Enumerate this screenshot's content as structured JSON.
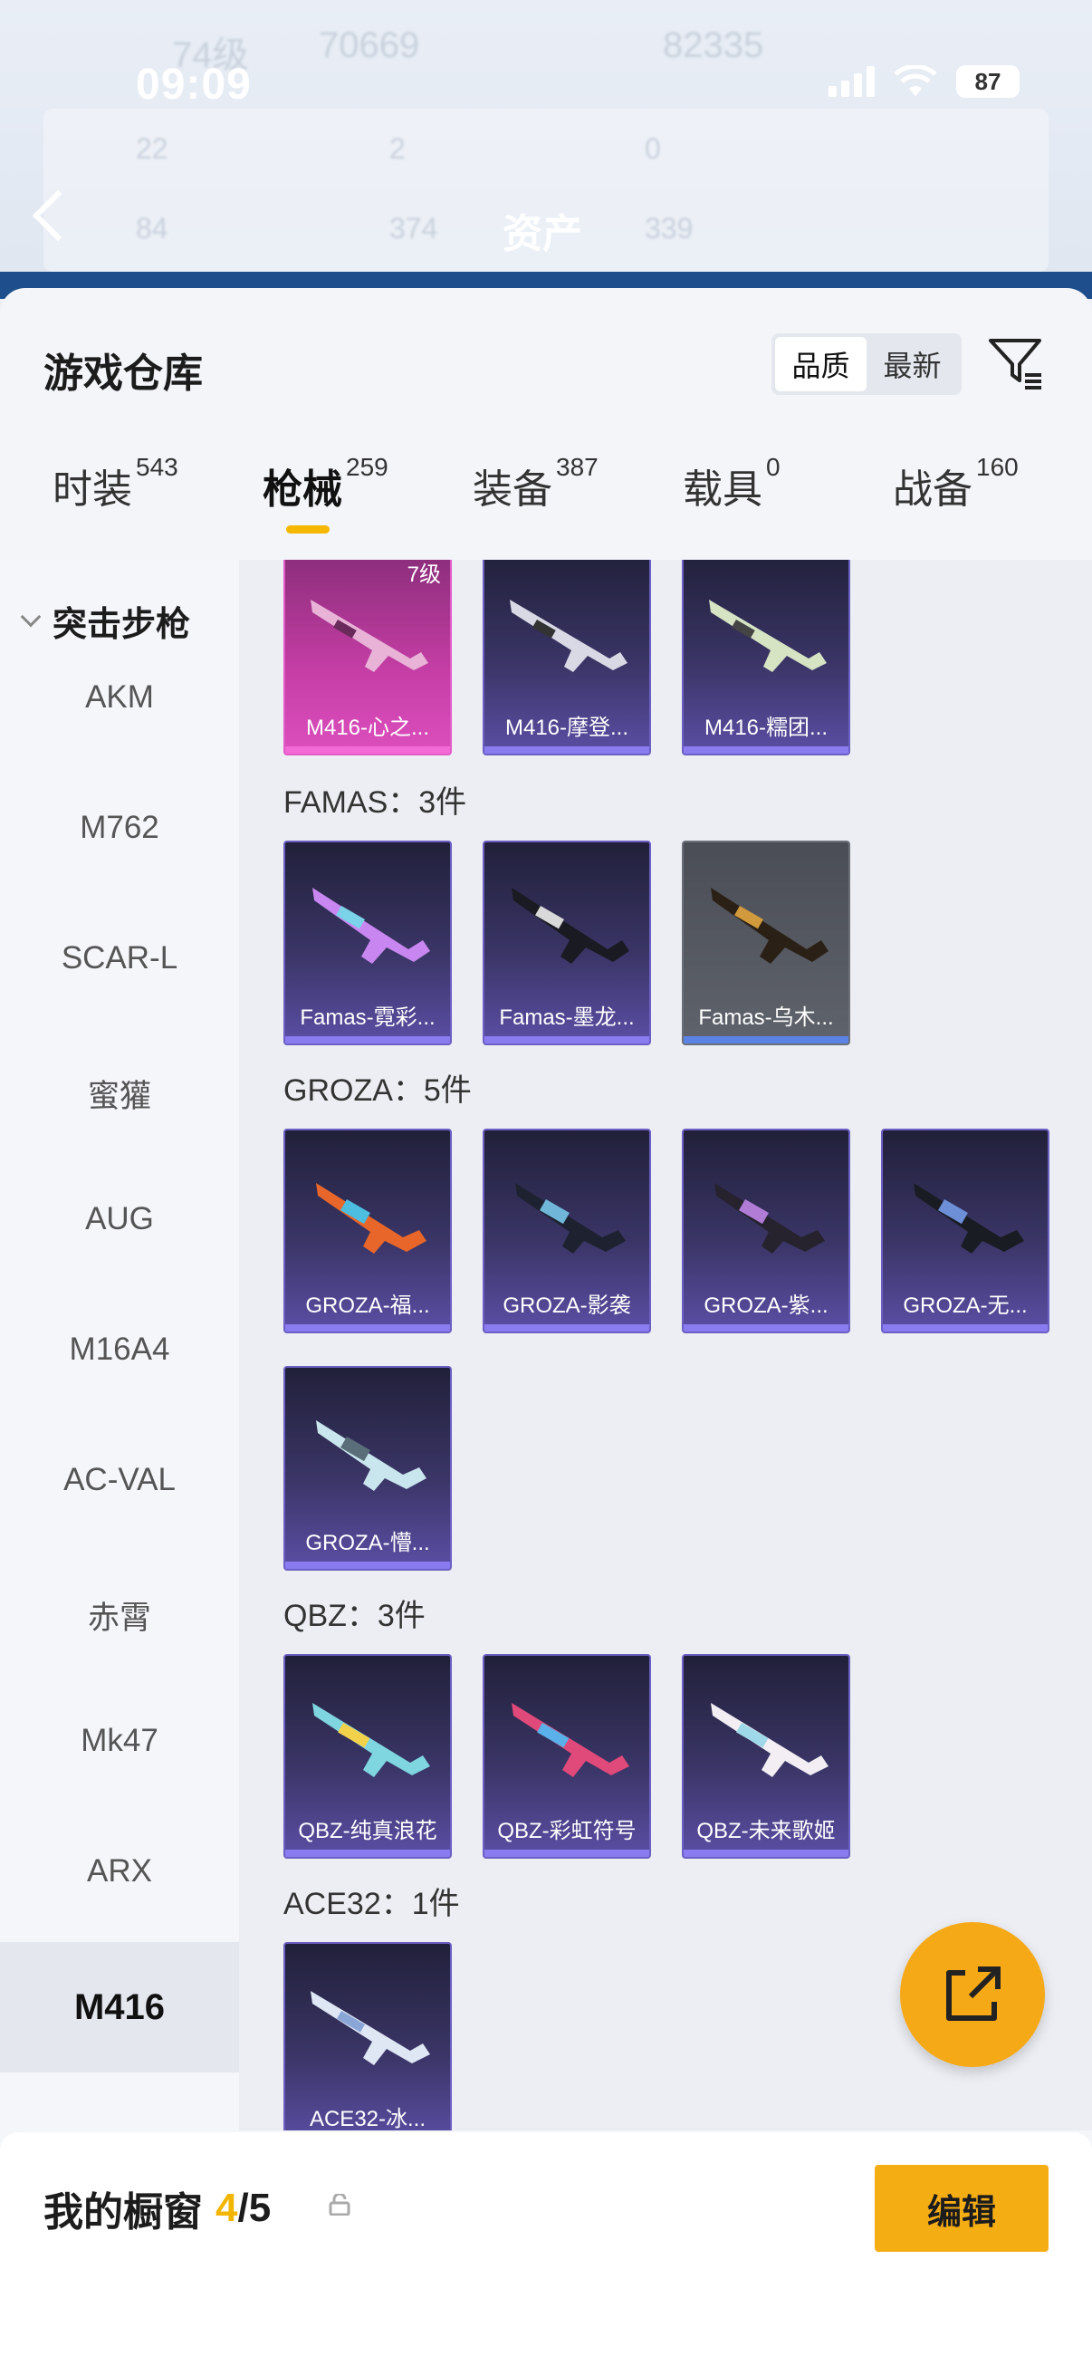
{
  "status_bar": {
    "time": "09:09",
    "battery": "87"
  },
  "background": {
    "ghost_texts": [
      "74级",
      "70669",
      "82335",
      "22",
      "2",
      "0",
      "84",
      "374",
      "339"
    ],
    "title": "资产"
  },
  "sheet": {
    "title": "游戏仓库",
    "sort": {
      "quality": "品质",
      "latest": "最新"
    },
    "tabs": [
      {
        "label": "时装",
        "count": "543"
      },
      {
        "label": "枪械",
        "count": "259"
      },
      {
        "label": "装备",
        "count": "387"
      },
      {
        "label": "载具",
        "count": "0"
      },
      {
        "label": "战备",
        "count": "160"
      }
    ],
    "category": "突击步枪",
    "nav_items": [
      "AKM",
      "M762",
      "SCAR-L",
      "蜜獾",
      "AUG",
      "M16A4",
      "AC-VAL",
      "赤霄",
      "Mk47",
      "ARX",
      "M416"
    ],
    "groups": {
      "m416": {
        "items": [
          {
            "name": "M416-心之...",
            "level": "7级"
          },
          {
            "name": "M416-摩登..."
          },
          {
            "name": "M416-糯团..."
          }
        ]
      },
      "famas": {
        "title": "FAMAS：3件",
        "items": [
          {
            "name": "Famas-霓彩..."
          },
          {
            "name": "Famas-墨龙..."
          },
          {
            "name": "Famas-乌木..."
          }
        ]
      },
      "groza": {
        "title": "GROZA：5件",
        "items": [
          {
            "name": "GROZA-福..."
          },
          {
            "name": "GROZA-影袭"
          },
          {
            "name": "GROZA-紫..."
          },
          {
            "name": "GROZA-无..."
          },
          {
            "name": "GROZA-懵..."
          }
        ]
      },
      "qbz": {
        "title": "QBZ：3件",
        "items": [
          {
            "name": "QBZ-纯真浪花"
          },
          {
            "name": "QBZ-彩虹符号"
          },
          {
            "name": "QBZ-未来歌姬"
          }
        ]
      },
      "ace32": {
        "title": "ACE32：1件",
        "items": [
          {
            "name": "ACE32-冰..."
          }
        ]
      }
    }
  },
  "bottom": {
    "label": "我的橱窗",
    "current": "4",
    "total": "/5",
    "edit": "编辑"
  },
  "colors": {
    "accent": "#f5ad14",
    "card": "#3a3566",
    "pink": "#c63ea6"
  }
}
